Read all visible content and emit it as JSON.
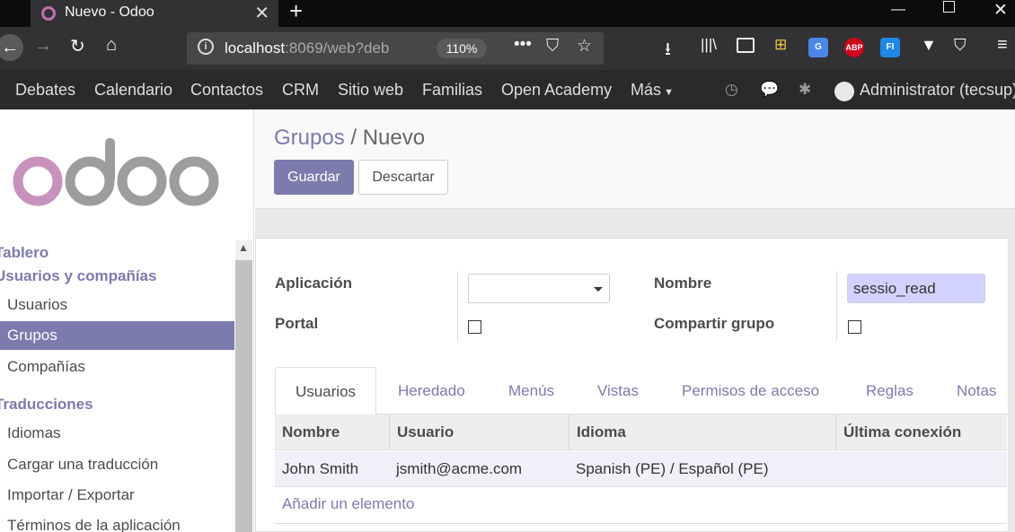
{
  "browser": {
    "tab_title": "Nuevo - Odoo",
    "url_host": "localhost",
    "url_rest": ":8069/web?deb",
    "zoom": "110%",
    "extensions": [
      "ABP",
      "FI"
    ]
  },
  "top_menu": {
    "items": [
      "Debates",
      "Calendario",
      "Contactos",
      "CRM",
      "Sitio web",
      "Familias",
      "Open Academy",
      "Más"
    ],
    "user": "Administrator (tecsup)"
  },
  "sidebar": {
    "logo_text": "odoo",
    "sections": [
      {
        "title": "Tablero",
        "items": []
      },
      {
        "title": "Usuarios y compañías",
        "items": [
          "Usuarios",
          "Grupos",
          "Compañías"
        ]
      },
      {
        "title": "Traducciones",
        "items": [
          "Idiomas",
          "Cargar una traducción",
          "Importar / Exportar",
          "Términos de la aplicación"
        ]
      }
    ],
    "active_item": "Grupos"
  },
  "control_panel": {
    "breadcrumb_parent": "Grupos",
    "breadcrumb_sep": "/",
    "breadcrumb_current": "Nuevo",
    "save_label": "Guardar",
    "discard_label": "Descartar"
  },
  "form": {
    "app_label": "Aplicación",
    "app_value": "",
    "portal_label": "Portal",
    "portal_checked": false,
    "name_label": "Nombre",
    "name_value": "sessio_read",
    "share_label": "Compartir grupo",
    "share_checked": false
  },
  "tabs": [
    "Usuarios",
    "Heredado",
    "Menús",
    "Vistas",
    "Permisos de acceso",
    "Reglas",
    "Notas"
  ],
  "active_tab": "Usuarios",
  "users_table": {
    "columns": [
      "Nombre",
      "Usuario",
      "Idioma",
      "Última conexión"
    ],
    "rows": [
      {
        "name": "John Smith",
        "login": "jsmith@acme.com",
        "lang": "Spanish (PE) / Español (PE)",
        "last": ""
      }
    ],
    "add_line": "Añadir un elemento"
  },
  "colors": {
    "accent": "#7c7bad",
    "menu_bg": "#2a2a2c",
    "browser_bg": "#323234",
    "name_field_bg": "#d2d2ff"
  }
}
